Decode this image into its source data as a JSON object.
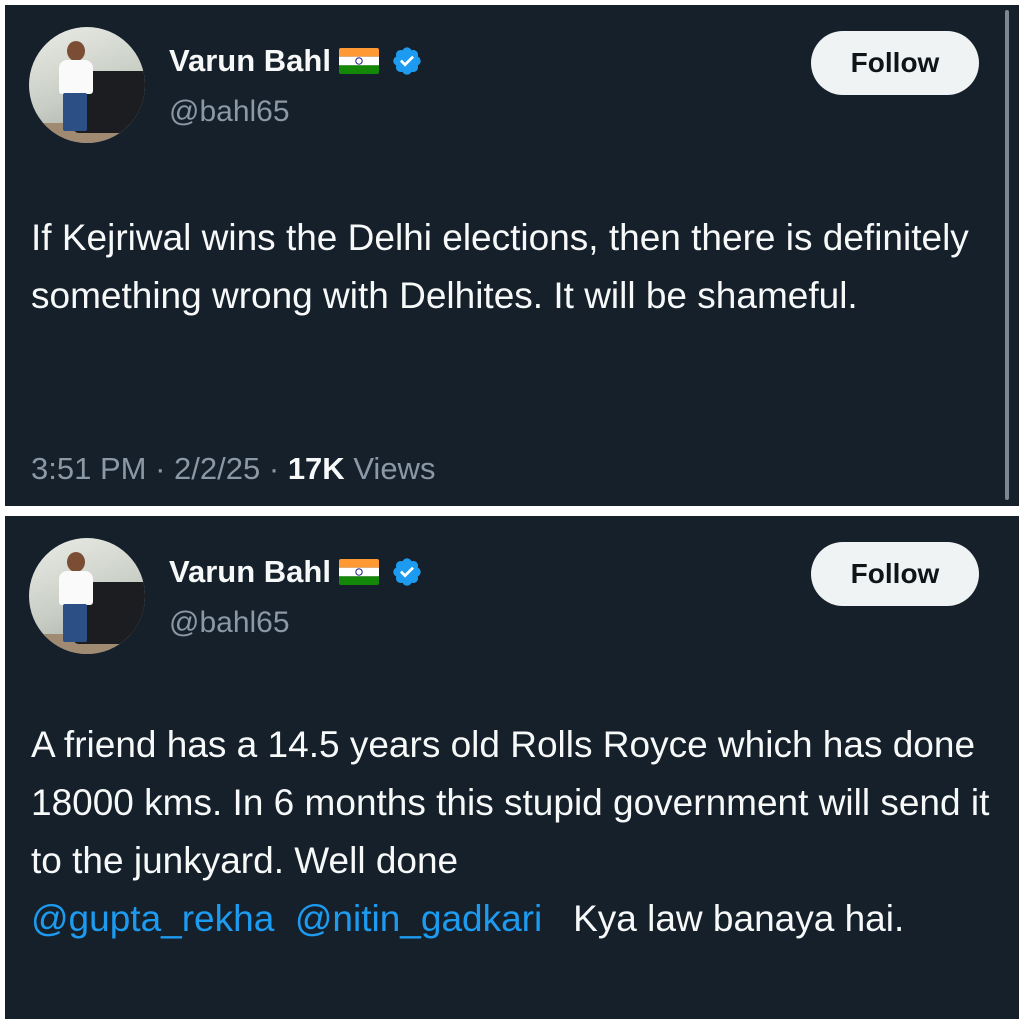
{
  "tweets": [
    {
      "author": {
        "name": "Varun Bahl",
        "flag": "india-flag-icon",
        "handle": "@bahl65",
        "verified": true
      },
      "follow_label": "Follow",
      "text": "If Kejriwal wins the Delhi elections, then there is definitely something wrong with Delhites. It will be shameful.",
      "time": "3:51 PM",
      "date": "2/2/25",
      "views_count": "17K",
      "views_label": "Views",
      "separator": "·"
    },
    {
      "author": {
        "name": "Varun Bahl",
        "flag": "india-flag-icon",
        "handle": "@bahl65",
        "verified": true
      },
      "follow_label": "Follow",
      "text_before": "A friend has a 14.5 years old Rolls Royce which has done 18000 kms. In 6 months this stupid government will send it to the junkyard. Well done ",
      "mention_1": "@gupta_rekha",
      "mention_2": "@nitin_gadkari",
      "text_after": "Kya law banaya hai."
    }
  ],
  "colors": {
    "background": "#15202b",
    "text": "#f7f9f9",
    "secondary": "#8b98a5",
    "accent": "#1d9bf0",
    "follow_button": "#eff3f4"
  }
}
